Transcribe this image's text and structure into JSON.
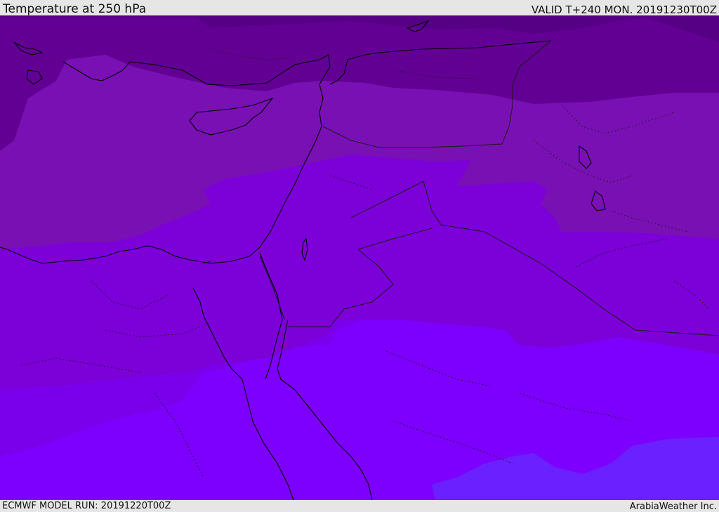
{
  "header": {
    "title": "Temperature at 250 hPa",
    "valid_time": "VALID T+240 MON. 20191230T00Z"
  },
  "footer": {
    "model_run": "ECMWF MODEL RUN: 20191220T00Z",
    "credit": "ArabiaWeather Inc."
  },
  "map": {
    "field": "temperature-250hPa",
    "palette": {
      "band_darkest": "#560086",
      "band_dark": "#620094",
      "band_mid_dark": "#7910b4",
      "band_mid": "#7c00d8",
      "band_mid_light": "#7a00ec",
      "band_light": "#7d00ff",
      "band_bluest": "#6a20ff",
      "coastline": "#000000",
      "border": "#1a1a1a"
    }
  }
}
